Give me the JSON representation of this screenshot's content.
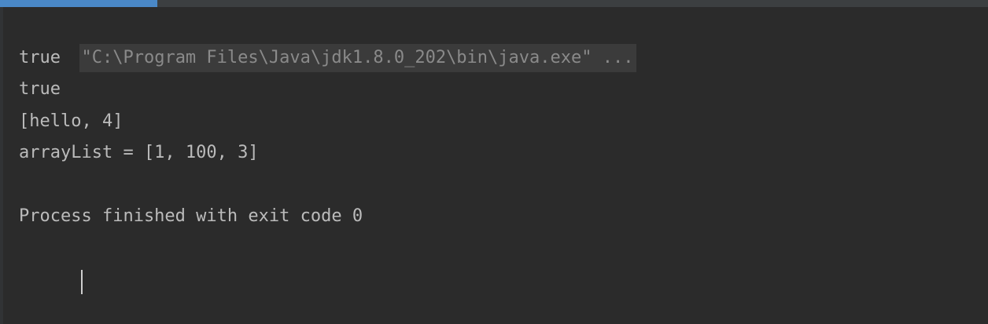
{
  "console": {
    "command_line": "\"C:\\Program Files\\Java\\jdk1.8.0_202\\bin\\java.exe\" ...",
    "output_lines": [
      "true",
      "true",
      "[hello, 4]",
      "arrayList = [1, 100, 3]",
      "",
      "Process finished with exit code 0"
    ]
  },
  "colors": {
    "background": "#2b2b2b",
    "text": "#bbbbbb",
    "command_text": "#8a8a8a",
    "command_highlight": "#3b3b3b",
    "accent": "#4a88c7"
  }
}
